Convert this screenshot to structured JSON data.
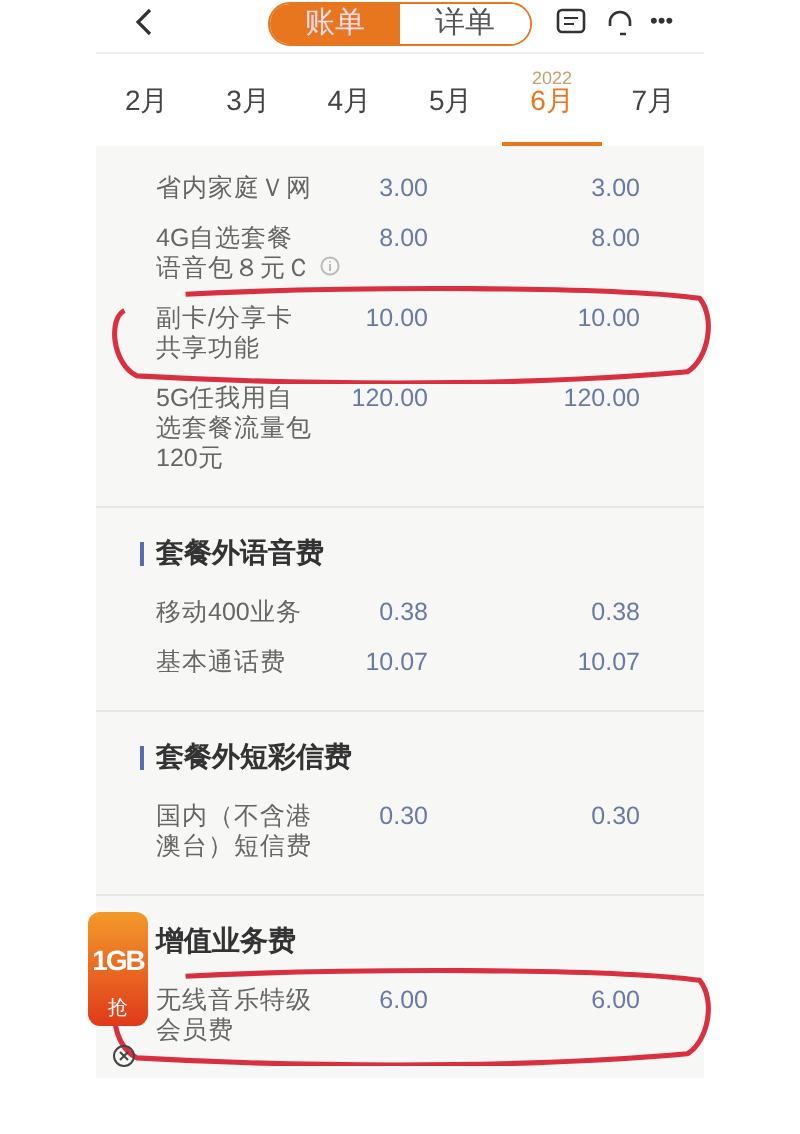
{
  "top_bar": {
    "tabs": [
      {
        "label": "账单",
        "selected": true
      },
      {
        "label": "详单",
        "selected": false
      }
    ],
    "more": "•••"
  },
  "months": [
    {
      "label": "2月",
      "selected": false
    },
    {
      "label": "3月",
      "selected": false
    },
    {
      "label": "4月",
      "selected": false
    },
    {
      "label": "5月",
      "selected": false
    },
    {
      "label": "6月",
      "selected": true,
      "year": "2022"
    },
    {
      "label": "7月",
      "selected": false
    }
  ],
  "sections": [
    {
      "rows": [
        {
          "name_lines": [
            "省内家庭Ｖ网"
          ],
          "value_1": "3.00",
          "value_2": "3.00",
          "info": false,
          "annotated": false
        },
        {
          "name_lines": [
            "4G自选套餐",
            "语音包８元Ｃ"
          ],
          "value_1": "8.00",
          "value_2": "8.00",
          "info": true,
          "annotated": false
        },
        {
          "name_lines": [
            "副卡/分享卡",
            "共享功能"
          ],
          "value_1": "10.00",
          "value_2": "10.00",
          "info": false,
          "annotated": true
        },
        {
          "name_lines": [
            "5G任我用自",
            "选套餐流量包",
            "120元"
          ],
          "value_1": "120.00",
          "value_2": "120.00",
          "info": false,
          "annotated": false
        }
      ]
    },
    {
      "title": "套餐外语音费",
      "rows": [
        {
          "name_lines": [
            "移动400业务"
          ],
          "value_1": "0.38",
          "value_2": "0.38",
          "info": false,
          "annotated": false
        },
        {
          "name_lines": [
            "基本通话费"
          ],
          "value_1": "10.07",
          "value_2": "10.07",
          "info": false,
          "annotated": false
        }
      ]
    },
    {
      "title": "套餐外短彩信费",
      "rows": [
        {
          "name_lines": [
            "国内（不含港",
            "澳台）短信费"
          ],
          "value_1": "0.30",
          "value_2": "0.30",
          "info": false,
          "annotated": false
        }
      ]
    },
    {
      "title": "增值业务费",
      "rows": [
        {
          "name_lines": [
            "无线音乐特级",
            "会员费"
          ],
          "value_1": "6.00",
          "value_2": "6.00",
          "info": false,
          "annotated": true
        }
      ]
    }
  ],
  "promo": {
    "badge": "1GB",
    "action": "抢"
  }
}
